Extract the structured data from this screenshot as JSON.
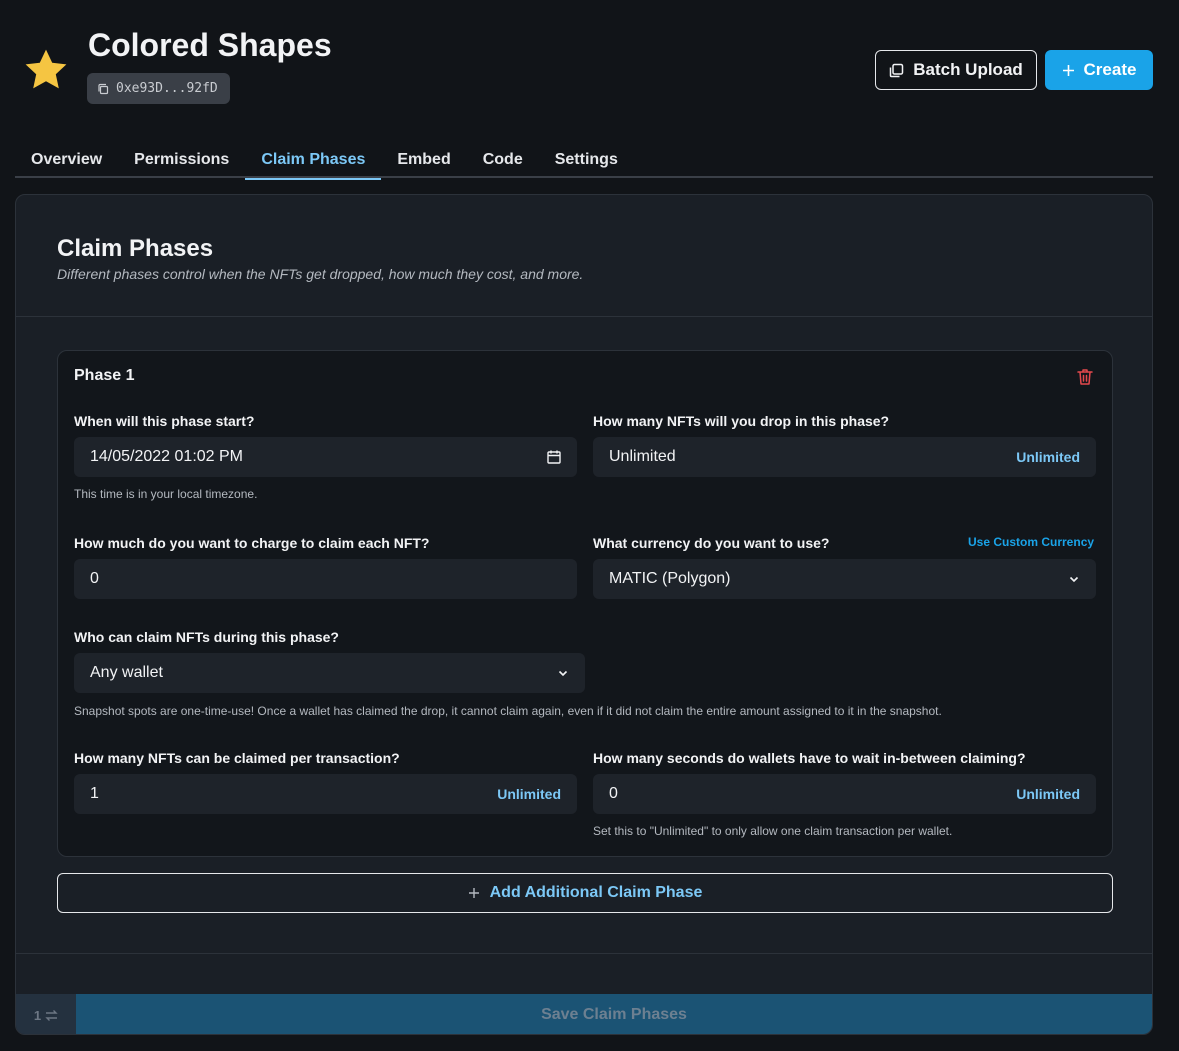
{
  "header": {
    "title": "Colored Shapes",
    "address": "0xe93D...92fD",
    "batch_upload_label": "Batch Upload",
    "create_label": "Create"
  },
  "tabs": [
    {
      "label": "Overview",
      "active": false
    },
    {
      "label": "Permissions",
      "active": false
    },
    {
      "label": "Claim Phases",
      "active": true
    },
    {
      "label": "Embed",
      "active": false
    },
    {
      "label": "Code",
      "active": false
    },
    {
      "label": "Settings",
      "active": false
    }
  ],
  "card": {
    "title": "Claim Phases",
    "subtitle": "Different phases control when the NFTs get dropped, how much they cost, and more."
  },
  "phase": {
    "title": "Phase 1",
    "start_label": "When will this phase start?",
    "start_value": "14/05/2022 01:02 PM",
    "start_hint": "This time is in your local timezone.",
    "supply_label": "How many NFTs will you drop in this phase?",
    "supply_value": "Unlimited",
    "supply_unlimited": "Unlimited",
    "price_label": "How much do you want to charge to claim each NFT?",
    "price_value": "0",
    "currency_label": "What currency do you want to use?",
    "currency_custom_link": "Use Custom Currency",
    "currency_value": "MATIC (Polygon)",
    "who_label": "Who can claim NFTs during this phase?",
    "who_value": "Any wallet",
    "snapshot_hint": "Snapshot spots are one-time-use! Once a wallet has claimed the drop, it cannot claim again, even if it did not claim the entire amount assigned to it in the snapshot.",
    "per_tx_label": "How many NFTs can be claimed per transaction?",
    "per_tx_value": "1",
    "per_tx_unlimited": "Unlimited",
    "wait_label": "How many seconds do wallets have to wait in-between claiming?",
    "wait_value": "0",
    "wait_unlimited": "Unlimited",
    "wait_hint": "Set this to \"Unlimited\" to only allow one claim transaction per wallet."
  },
  "add_phase_label": "Add Additional Claim Phase",
  "save": {
    "count": "1",
    "label": "Save Claim Phases"
  },
  "colors": {
    "accent": "#1aa3e8",
    "link": "#7cc8f6",
    "danger": "#e5484d",
    "star": "#f5c542"
  },
  "icons": [
    "star-icon",
    "copy-icon",
    "batch-upload-icon",
    "plus-icon",
    "trash-icon",
    "calendar-icon",
    "chevron-down-icon",
    "swap-icon"
  ]
}
